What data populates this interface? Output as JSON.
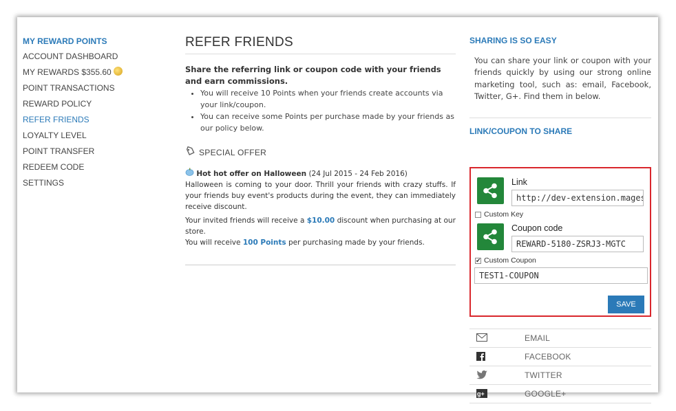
{
  "nav": {
    "heading": "MY REWARD POINTS",
    "items": [
      {
        "label": "ACCOUNT DASHBOARD"
      },
      {
        "label": "MY REWARDS $355.60"
      },
      {
        "label": "POINT TRANSACTIONS"
      },
      {
        "label": "REWARD POLICY"
      },
      {
        "label": "REFER FRIENDS"
      },
      {
        "label": "LOYALTY LEVEL"
      },
      {
        "label": "POINT TRANSFER"
      },
      {
        "label": "REDEEM CODE"
      },
      {
        "label": "SETTINGS"
      }
    ],
    "active_color": "#2b7ab8"
  },
  "main": {
    "title": "REFER FRIENDS",
    "intro": "Share the referring link or coupon code with your friends and earn commissions.",
    "bullets": [
      "You will receive 10 Points when your friends create accounts via your link/coupon.",
      "You can receive some Points per purchase made by your friends as our policy below."
    ],
    "special_title": "SPECIAL OFFER",
    "offer": {
      "name": "Hot hot offer on Halloween",
      "dates": " (24 Jul 2015 - 24 Feb 2016)",
      "desc": "Halloween is coming to your door. Thrill your friends with crazy stuffs. If your friends buy event's products during the event, they can immediately receive discount.",
      "line1_pre": "Your invited friends will receive a ",
      "line1_amount": "$10.00",
      "line1_post": " discount when purchasing at our store.",
      "line2_pre": "You will receive ",
      "line2_amount": "100 Points",
      "line2_post": " per purchasing made by your friends."
    }
  },
  "right": {
    "heading": "SHARING IS SO EASY",
    "text": "You can share your link or coupon with your friends quickly by using our strong online marketing tool, such as: email, Facebook, Twitter, G+. Find them in below.",
    "link_heading": "LINK/COUPON TO SHARE",
    "link_label": "Link",
    "link_value": "http://dev-extension.magestore.com",
    "custom_key_label": "Custom Key",
    "custom_key_checked": false,
    "coupon_label": "Coupon code",
    "coupon_value": "REWARD-5180-ZSRJ3-MGTC",
    "custom_coupon_label": "Custom Coupon",
    "custom_coupon_checked": true,
    "custom_coupon_value": "TEST1-COUPON",
    "save_label": "SAVE",
    "social": [
      {
        "label": "EMAIL",
        "icon": "email-icon"
      },
      {
        "label": "FACEBOOK",
        "icon": "facebook-icon"
      },
      {
        "label": "TWITTER",
        "icon": "twitter-icon"
      },
      {
        "label": "GOOGLE+",
        "icon": "google-plus-icon"
      }
    ],
    "highlight_color": "#d9262c",
    "share_icon_color": "#23873a"
  }
}
